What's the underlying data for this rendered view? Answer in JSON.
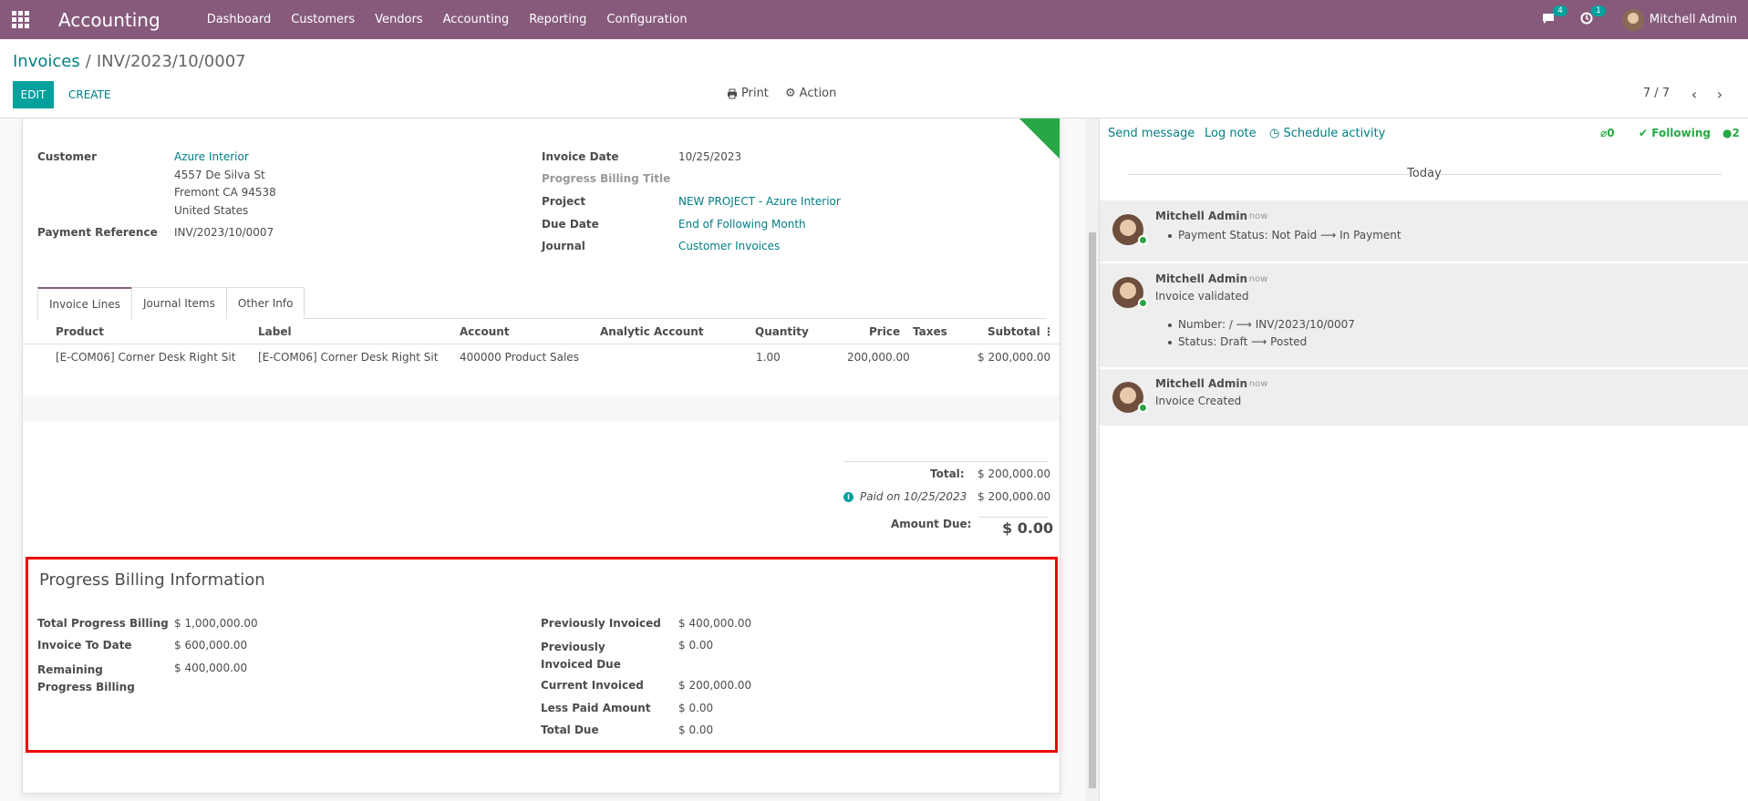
{
  "navbar": {
    "app_name": "Accounting",
    "menu": [
      "Dashboard",
      "Customers",
      "Vendors",
      "Accounting",
      "Reporting",
      "Configuration"
    ],
    "messages_count": "4",
    "activities_count": "1",
    "user_name": "Mitchell Admin"
  },
  "breadcrumb": {
    "parent": "Invoices",
    "separator": "/",
    "current": "INV/2023/10/0007"
  },
  "toolbar": {
    "edit": "EDIT",
    "create": "CREATE",
    "print": "Print",
    "action": "Action",
    "pager": "7 / 7"
  },
  "form": {
    "customer_label": "Customer",
    "customer_name": "Azure Interior",
    "address": [
      "4557 De Silva St",
      "Fremont CA 94538",
      "United States"
    ],
    "payment_reference_label": "Payment Reference",
    "payment_reference": "INV/2023/10/0007",
    "invoice_date_label": "Invoice Date",
    "invoice_date": "10/25/2023",
    "progress_billing_title_label": "Progress Billing Title",
    "project_label": "Project",
    "project": "NEW PROJECT - Azure Interior",
    "due_date_label": "Due Date",
    "due_date": "End of Following Month",
    "journal_label": "Journal",
    "journal": "Customer Invoices"
  },
  "tabs": [
    "Invoice Lines",
    "Journal Items",
    "Other Info"
  ],
  "lines": {
    "headers": {
      "product": "Product",
      "label": "Label",
      "account": "Account",
      "analytic": "Analytic Account",
      "quantity": "Quantity",
      "price": "Price",
      "taxes": "Taxes",
      "subtotal": "Subtotal"
    },
    "rows": [
      {
        "product": "[E-COM06] Corner Desk Right Sit",
        "label": "[E-COM06] Corner Desk Right Sit",
        "account": "400000 Product Sales",
        "analytic": "",
        "quantity": "1.00",
        "price": "200,000.00",
        "taxes": "",
        "subtotal": "$ 200,000.00"
      }
    ]
  },
  "totals": {
    "total_label": "Total:",
    "total": "$ 200,000.00",
    "paid_label": "Paid on 10/25/2023",
    "paid": "$ 200,000.00",
    "amount_due_label": "Amount Due:",
    "amount_due": "$ 0.00"
  },
  "progress_billing": {
    "title": "Progress Billing Information",
    "left": [
      {
        "label": "Total Progress Billing",
        "value": "$ 1,000,000.00"
      },
      {
        "label": "Invoice To Date",
        "value": "$ 600,000.00"
      },
      {
        "label": "Remaining Progress Billing",
        "value": "$ 400,000.00"
      }
    ],
    "right": [
      {
        "label": "Previously Invoiced",
        "value": "$ 400,000.00"
      },
      {
        "label": "Previously Invoiced Due",
        "value": "$ 0.00"
      },
      {
        "label": "Current Invoiced",
        "value": "$ 200,000.00"
      },
      {
        "label": "Less Paid Amount",
        "value": "$ 0.00"
      },
      {
        "label": "Total Due",
        "value": "$ 0.00"
      }
    ]
  },
  "chatter": {
    "send_message": "Send message",
    "log_note": "Log note",
    "schedule_activity": "Schedule activity",
    "attachments": "0",
    "following": "Following",
    "followers": "2",
    "today": "Today",
    "messages": [
      {
        "author": "Mitchell Admin",
        "time": "- now",
        "text": "",
        "bullets": [
          "Payment Status: Not Paid ⟶ In Payment"
        ]
      },
      {
        "author": "Mitchell Admin",
        "time": "- now",
        "text": "Invoice validated",
        "bullets": [
          "Number: / ⟶ INV/2023/10/0007",
          "Status: Draft ⟶ Posted"
        ]
      },
      {
        "author": "Mitchell Admin",
        "time": "- now",
        "text": "Invoice Created",
        "bullets": []
      }
    ]
  },
  "colors": {
    "navbar": "#875a7b",
    "primary": "#00a09d",
    "link": "#017e84",
    "highlight_border": "#ee0000",
    "ribbon": "#28a745"
  }
}
